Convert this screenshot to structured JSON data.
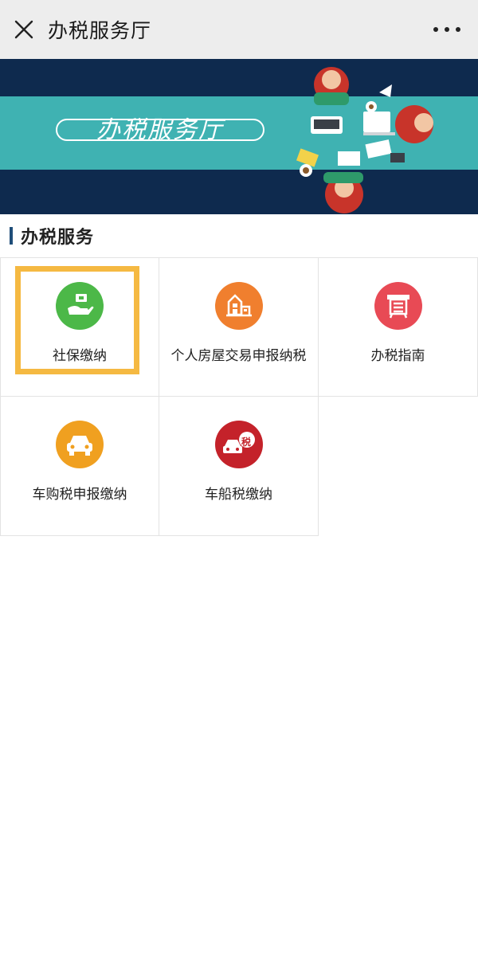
{
  "titlebar": {
    "title": "办税服务厅"
  },
  "banner": {
    "title": "办税服务厅"
  },
  "section": {
    "title": "办税服务"
  },
  "services": [
    {
      "label": "社保缴纳",
      "icon": "hand-money-icon",
      "color": "#4cb848",
      "highlighted": true
    },
    {
      "label": "个人房屋交易申报纳税",
      "icon": "house-icon",
      "color": "#f07f2e"
    },
    {
      "label": "办税指南",
      "icon": "document-board-icon",
      "color": "#e84a55"
    },
    {
      "label": "车购税申报缴纳",
      "icon": "car-icon",
      "color": "#f0a020"
    },
    {
      "label": "车船税缴纳",
      "icon": "car-tax-icon",
      "color": "#c4222a",
      "badge": "税"
    }
  ],
  "colors": {
    "highlight": "#f5b942",
    "banner_navy": "#0e2a4e",
    "banner_teal": "#3fb2b2",
    "section_bar": "#1f4e79"
  }
}
